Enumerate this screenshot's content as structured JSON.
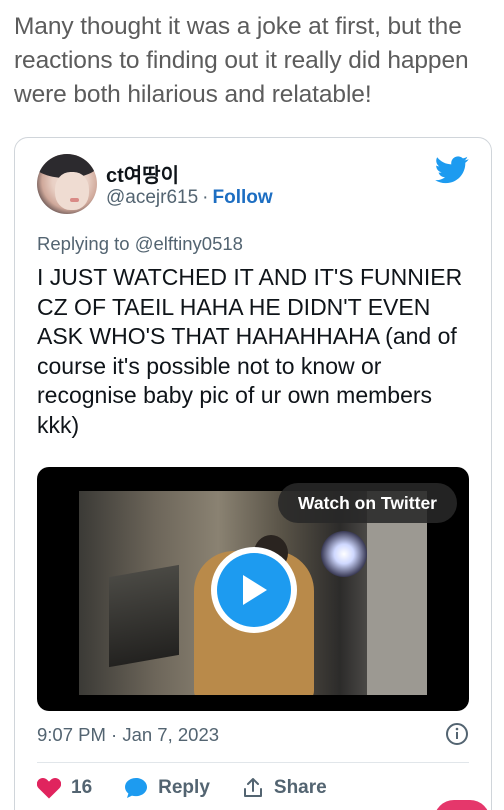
{
  "intro_text": "Many thought it was a joke at first, but the reactions to finding out it really did happen were both hilarious and relatable!",
  "tweet": {
    "display_name": "ct여땅이",
    "handle": "@acejr615",
    "separator": "·",
    "follow_label": "Follow",
    "reply_prefix": "Replying to ",
    "reply_to": "@elftiny0518",
    "text": "I JUST WATCHED IT AND IT'S FUNNIER CZ OF TAEIL HAHA HE DIDN'T EVEN ASK WHO'S THAT HAHAHHAHA (and of course it's possible not to know or recognise baby pic of ur own members kkk)",
    "media": {
      "watch_label": "Watch on Twitter",
      "play_icon": "play-icon"
    },
    "timestamp": "9:07 PM · Jan 7, 2023",
    "actions": {
      "like_count": "16",
      "reply_label": "Reply",
      "share_label": "Share"
    }
  },
  "colors": {
    "accent": "#1d9bf0",
    "follow": "#1d6ec2",
    "like": "#e0245e",
    "muted": "#536471"
  },
  "icons": [
    "twitter-bird-icon",
    "info-icon",
    "heart-icon",
    "reply-bubble-icon",
    "share-icon",
    "play-icon"
  ]
}
